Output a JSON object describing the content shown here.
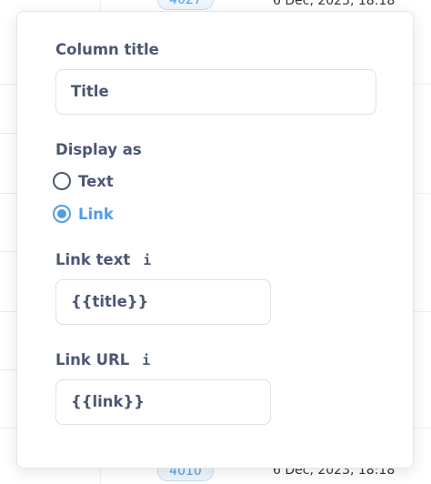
{
  "background_table": {
    "top_row": {
      "id": "4027",
      "date": "6 Dec, 2023, 18:18"
    },
    "bottom_row": {
      "id": "4010",
      "date": "6 Dec, 2023, 18:18"
    }
  },
  "column_settings": {
    "column_title_label": "Column title",
    "column_title_value": "Title",
    "display_as_label": "Display as",
    "display_options": [
      {
        "label": "Text",
        "selected": false
      },
      {
        "label": "Link",
        "selected": true
      }
    ],
    "link_text_label": "Link text",
    "link_text_value": "{{title}}",
    "link_url_label": "Link URL",
    "link_url_value": "{{link}}",
    "info_icon_glyph": "i"
  },
  "colors": {
    "accent": "#509ee3",
    "text": "#4c5773",
    "border": "#dce1e5"
  }
}
